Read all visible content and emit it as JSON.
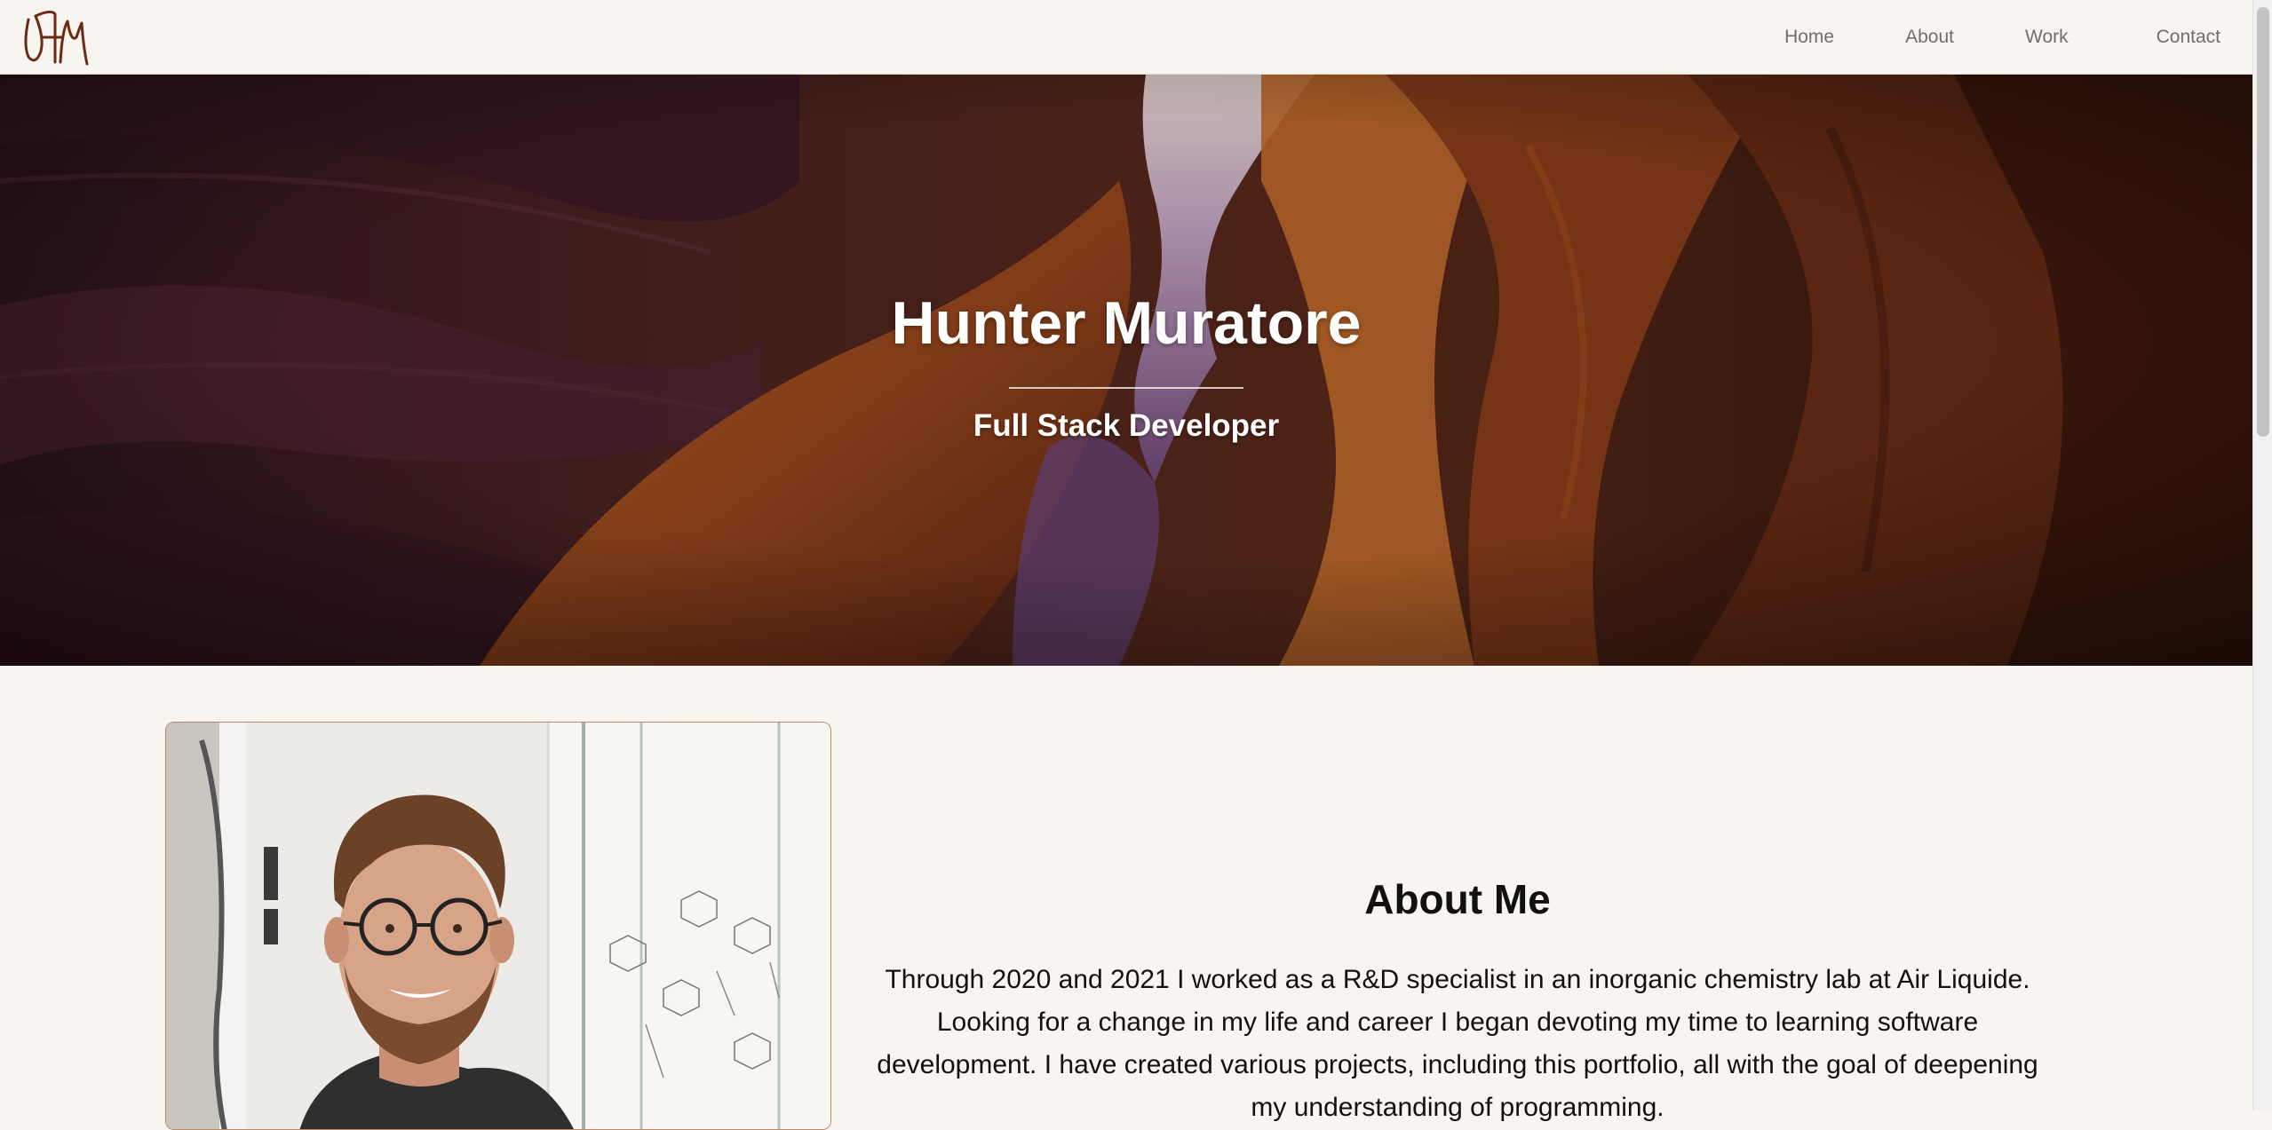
{
  "logo": {
    "text": "HM"
  },
  "nav": {
    "items": [
      {
        "label": "Home"
      },
      {
        "label": "About"
      },
      {
        "label": "Work"
      },
      {
        "label": "Contact"
      }
    ]
  },
  "hero": {
    "title": "Hunter Muratore",
    "subtitle": "Full Stack Developer"
  },
  "about": {
    "heading": "About Me",
    "text": "Through 2020 and 2021 I worked as a R&D specialist in an inorganic chemistry lab at Air Liquide. Looking for a change in my life and career I began devoting my time to learning software development. I have created various projects, including this portfolio, all with the goal of deepening my understanding of programming."
  },
  "colors": {
    "background": "#f8f4ef",
    "nav_text": "#6f6f6f",
    "logo": "#6b2a12",
    "photo_border": "#b98a66"
  }
}
